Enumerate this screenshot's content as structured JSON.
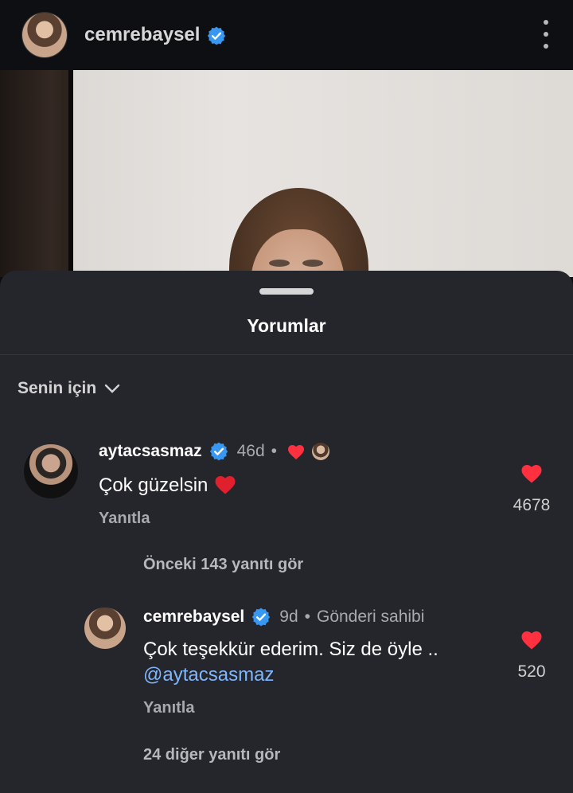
{
  "post_header": {
    "username": "cemrebaysel"
  },
  "sheet": {
    "title": "Yorumlar",
    "filter_label": "Senin için"
  },
  "comments": [
    {
      "username": "aytacsasmaz",
      "time": "46d",
      "dot": "•",
      "text": "Çok güzelsin",
      "reply_label": "Yanıtla",
      "like_count": "4678"
    }
  ],
  "view_previous": "Önceki 143 yanıtı gör",
  "reply": {
    "username": "cemrebaysel",
    "time": "9d",
    "dot": "•",
    "owner_label": "Gönderi sahibi",
    "text": "Çok teşekkür ederim. Siz de öyle ..",
    "mention": "@aytacsasmaz",
    "reply_label": "Yanıtla",
    "like_count": "520"
  },
  "view_more": "24 diğer yanıtı gör",
  "colors": {
    "verified": "#3897f0",
    "heart": "#ff3040",
    "sheet_bg": "#24262b",
    "mention": "#7fb6ff"
  },
  "icons": {
    "verified": "verified-badge-icon",
    "heart": "heart-icon",
    "menu": "more-vertical-icon",
    "chevron": "chevron-down-icon"
  }
}
